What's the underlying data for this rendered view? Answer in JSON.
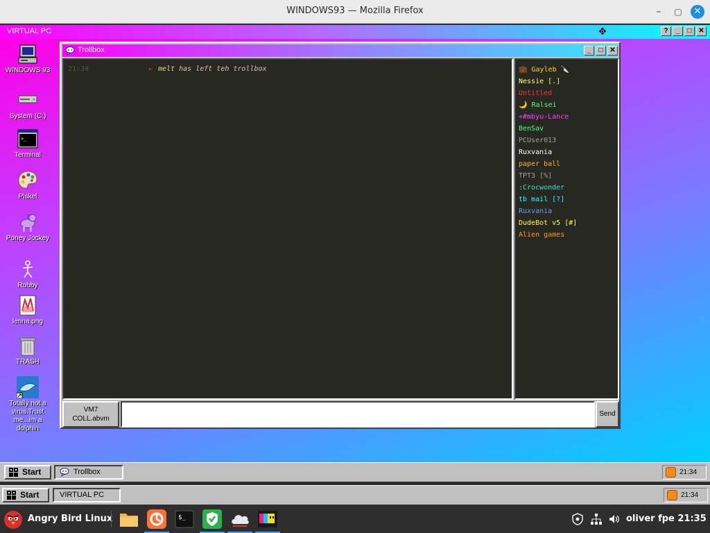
{
  "browser": {
    "title": "WINDOWS93 — Mozilla Firefox",
    "min": "–",
    "max": "▢",
    "close": "✕"
  },
  "virtual_pc": {
    "title": "VIRTUAL PC",
    "help": "?",
    "min": "_",
    "max": "□",
    "close": "✕",
    "move_icon": "✥"
  },
  "desktop_icons": [
    {
      "label": "WINDOWS 93",
      "icon": "computer-icon"
    },
    {
      "label": "System (C:)",
      "icon": "drive-icon"
    },
    {
      "label": "Terminal",
      "icon": "terminal-icon"
    },
    {
      "label": "Piskel",
      "icon": "palette-icon"
    },
    {
      "label": "Poney Jockey",
      "icon": "pony-icon"
    },
    {
      "label": "Robby",
      "icon": "stickman-icon"
    },
    {
      "label": "lenna.png",
      "icon": "image-file-icon"
    },
    {
      "label": "TRASH",
      "icon": "trash-icon"
    },
    {
      "label": "Totally not a virus.Trust me...im a dolphin",
      "icon": "dolphin-icon"
    }
  ],
  "trollbox": {
    "title": "Trollbox",
    "min": "_",
    "max": "□",
    "close": "✕",
    "messages": [
      {
        "time": "21:34",
        "arrow": "←",
        "nick": "melt",
        "text": "has left teh trollbox"
      }
    ],
    "users": [
      {
        "name": "💼 Gayleb 🔪",
        "color": "#ffd700"
      },
      {
        "name": "Nessie [.]",
        "color": "#ffff66"
      },
      {
        "name": "Untitled",
        "color": "#ff3030"
      },
      {
        "name": "🌙 Ralsei",
        "color": "#5dff73"
      },
      {
        "name": "+#mbyu-Lance",
        "color": "#ff40ff"
      },
      {
        "name": "BenSav",
        "color": "#4dff88"
      },
      {
        "name": "PCUser013",
        "color": "#a0a0a0"
      },
      {
        "name": "Ruxvania",
        "color": "#ffffff"
      },
      {
        "name": "paper ball",
        "color": "#ffb020"
      },
      {
        "name": "TPT3 [%]",
        "color": "#a0a0a0"
      },
      {
        "name": ":Crocwonder",
        "color": "#44e0d0"
      },
      {
        "name": "tb mail [?]",
        "color": "#22ffff"
      },
      {
        "name": "Ruxvania",
        "color": "#6a9cff"
      },
      {
        "name": "DudeBot v5 [#]",
        "color": "#ffff33"
      },
      {
        "name": "Alien games",
        "color": "#ff9a1f"
      }
    ],
    "vm_button": {
      "line1": "VM7",
      "line2": "COLL.abvm"
    },
    "input": {
      "value": "",
      "placeholder": ""
    },
    "send_label": "Send"
  },
  "taskbar_inner": {
    "start_label": "Start",
    "task_label": "Trollbox",
    "clock": "21:34"
  },
  "taskbar_outer": {
    "start_label": "Start",
    "task_label": "VIRTUAL PC",
    "clock": "21:34"
  },
  "linux_panel": {
    "app_label": "Angry Bird Linux",
    "clock": "oliver fpe 21:35",
    "launchers": [
      "folder-icon",
      "firefox-icon",
      "terminal-icon",
      "vpn-shield-icon",
      "cloud-icon",
      "pixel-game-icon"
    ],
    "status_icons": [
      "shield-status-icon",
      "network-icon",
      "volume-icon"
    ]
  }
}
